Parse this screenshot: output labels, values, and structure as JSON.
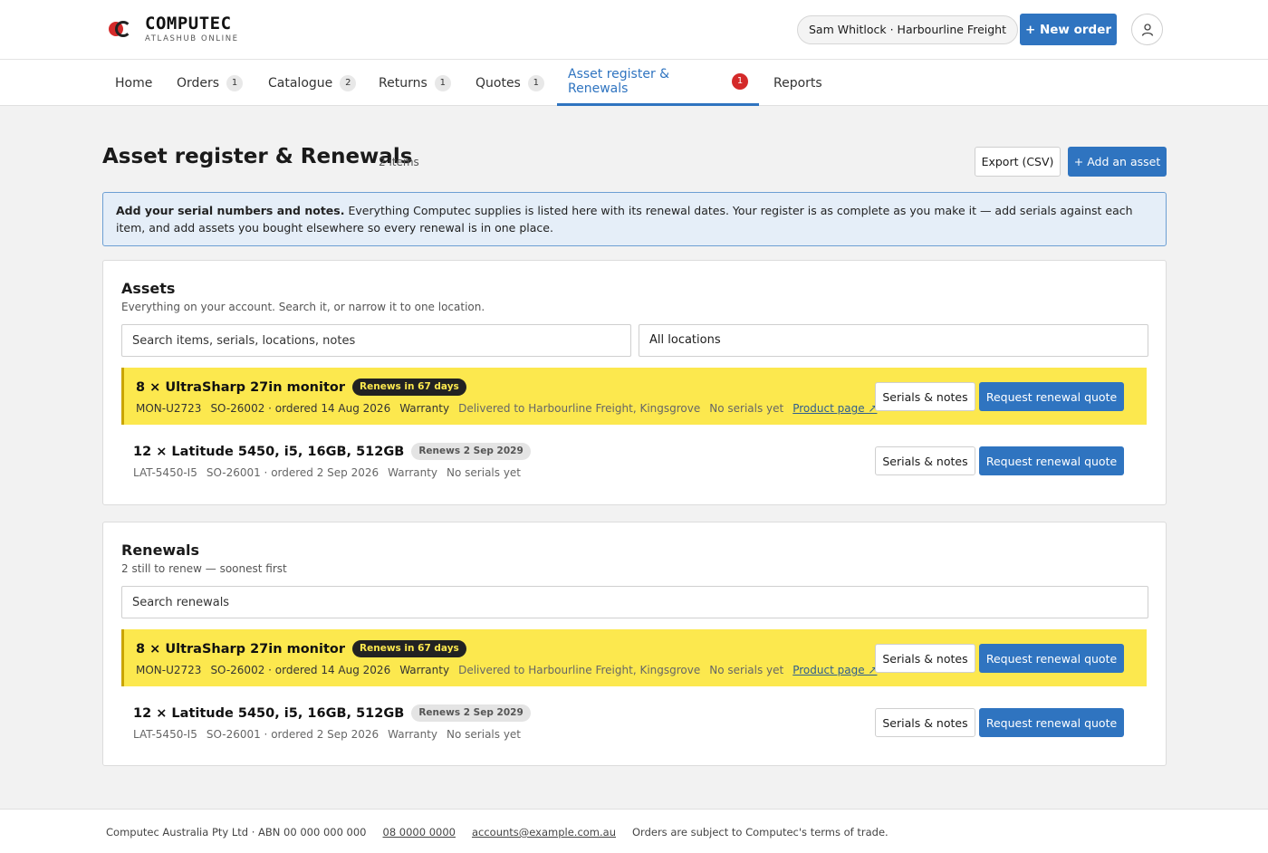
{
  "header": {
    "brand_name": "COMPUTEC",
    "brand_sub": "ATLASHUB ONLINE",
    "account": "Sam Whitlock · Harbourline Freight",
    "new_order": "+ New order"
  },
  "nav": {
    "tabs": [
      {
        "label": "Home",
        "count": ""
      },
      {
        "label": "Orders",
        "count": "1"
      },
      {
        "label": "Catalogue",
        "count": "2"
      },
      {
        "label": "Returns",
        "count": "1"
      },
      {
        "label": "Quotes",
        "count": "1"
      },
      {
        "label": "Asset register & Renewals",
        "count": "1",
        "active": true
      },
      {
        "label": "Reports",
        "count": ""
      }
    ]
  },
  "page": {
    "title": "Asset register & Renewals",
    "count": "2 items",
    "export_label": "Export (CSV)",
    "add_asset_label": "+ Add an asset"
  },
  "banner": {
    "bold": "Add your serial numbers and notes.",
    "text": " Everything Computec supplies is listed here with its renewal dates. Your register is as complete as you make it — add serials against each item, and add assets you bought elsewhere so every renewal is in one place."
  },
  "assets": {
    "title": "Assets",
    "subtitle": "Everything on your account. Search it, or narrow it to one location.",
    "search_placeholder": "Search items, serials, locations, notes",
    "location_value": "All locations",
    "rows": [
      {
        "title": "8 × UltraSharp 27in monitor",
        "badge": "Renews in 67 days",
        "sku": "MON-U2723",
        "order": "SO-26002 · ordered 14 Aug 2026",
        "coverage": "Warranty",
        "delivery": "Delivered to Harbourline Freight, Kingsgrove",
        "serials": "No serials yet",
        "link": "Product page ↗",
        "serials_btn": "Serials & notes",
        "quote_btn": "Request renewal quote"
      },
      {
        "title": "12 × Latitude 5450, i5, 16GB, 512GB",
        "badge": "Renews 2 Sep 2029",
        "sku": "LAT-5450-I5",
        "order": "SO-26001 · ordered 2 Sep 2026",
        "coverage": "Warranty",
        "serials": "No serials yet",
        "serials_btn": "Serials & notes",
        "quote_btn": "Request renewal quote"
      }
    ]
  },
  "renewals": {
    "title": "Renewals",
    "subtitle": "2 still to renew — soonest first",
    "search_placeholder": "Search renewals",
    "rows": [
      {
        "title": "8 × UltraSharp 27in monitor",
        "badge": "Renews in 67 days",
        "sku": "MON-U2723",
        "order": "SO-26002 · ordered 14 Aug 2026",
        "coverage": "Warranty",
        "delivery": "Delivered to Harbourline Freight, Kingsgrove",
        "serials": "No serials yet",
        "link": "Product page ↗",
        "serials_btn": "Serials & notes",
        "quote_btn": "Request renewal quote"
      },
      {
        "title": "12 × Latitude 5450, i5, 16GB, 512GB",
        "badge": "Renews 2 Sep 2029",
        "sku": "LAT-5450-I5",
        "order": "SO-26001 · ordered 2 Sep 2026",
        "coverage": "Warranty",
        "serials": "No serials yet",
        "serials_btn": "Serials & notes",
        "quote_btn": "Request renewal quote"
      }
    ]
  },
  "footer": {
    "company": "Computec Australia Pty Ltd · ABN 00 000 000 000",
    "phone": "08 0000 0000",
    "email": "accounts@example.com.au",
    "terms": "Orders are subject to Computec's terms of trade."
  },
  "colors": {
    "accent": "#2f74c0",
    "alert": "#d42a2a",
    "highlight": "#fce84e"
  }
}
